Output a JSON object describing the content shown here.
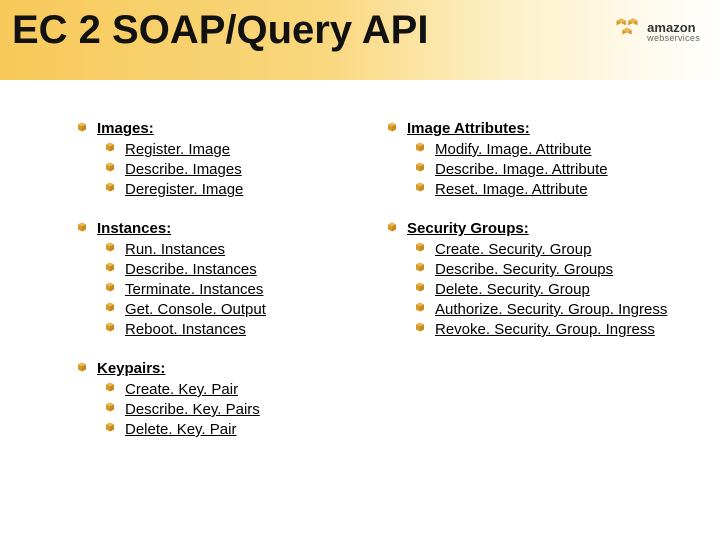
{
  "title": "EC 2 SOAP/Query API",
  "logo": {
    "top": "amazon",
    "bottom": "webservices"
  },
  "left": [
    {
      "name": "images",
      "title": "Images:",
      "items": [
        "Register. Image",
        "Describe. Images",
        "Deregister. Image"
      ]
    },
    {
      "name": "instances",
      "title": "Instances:",
      "items": [
        "Run. Instances",
        "Describe. Instances",
        "Terminate. Instances",
        "Get. Console. Output",
        "Reboot. Instances"
      ]
    },
    {
      "name": "keypairs",
      "title": "Keypairs:",
      "items": [
        "Create. Key. Pair",
        "Describe. Key. Pairs",
        "Delete. Key. Pair"
      ]
    }
  ],
  "right": [
    {
      "name": "image-attributes",
      "title": "Image Attributes:",
      "items": [
        "Modify. Image. Attribute",
        "Describe. Image. Attribute",
        "Reset. Image. Attribute"
      ]
    },
    {
      "name": "security-groups",
      "title": "Security Groups:",
      "items": [
        "Create. Security. Group",
        "Describe. Security. Groups",
        "Delete. Security. Group",
        "Authorize. Security. Group. Ingress",
        "Revoke. Security. Group. Ingress"
      ]
    }
  ]
}
